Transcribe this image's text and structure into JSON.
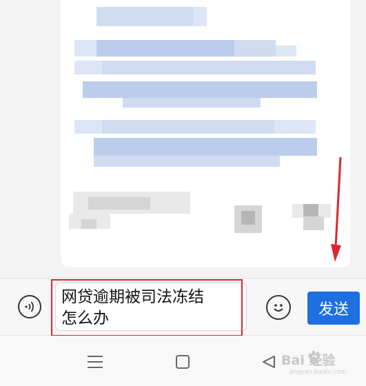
{
  "input_bar": {
    "message_text_line1": "网贷逾期被司法冻结",
    "message_text_line2": "怎么办",
    "send_label": "发送"
  },
  "watermark": {
    "brand": "Bai  经验",
    "url": "jingyan.baidu.com"
  },
  "colors": {
    "send_button": "#1e6fe0",
    "highlight": "#e0232c",
    "arrow": "#e0232c"
  },
  "icons": {
    "voice": "voice-wave-icon",
    "emoji": "smiley-face-icon",
    "nav_menu": "menu-lines-icon",
    "nav_home": "square-home-icon",
    "nav_back": "triangle-back-icon"
  }
}
